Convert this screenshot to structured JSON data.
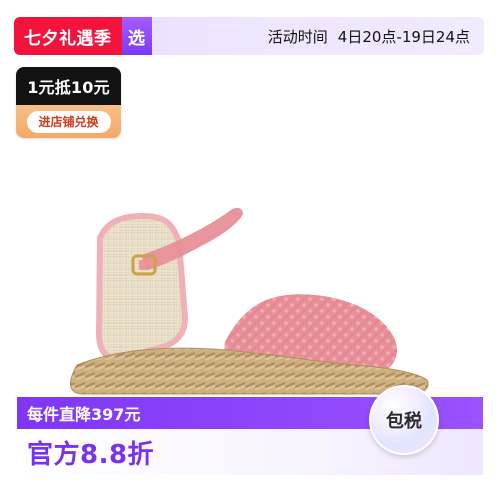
{
  "top_banner": {
    "festival_label": "七夕礼遇季",
    "select_label": "选",
    "activity_label": "活动时间",
    "activity_time": "4日20点-19日24点"
  },
  "coupon": {
    "title": "1元抵10元",
    "button_label": "进店铺兑换"
  },
  "product": {
    "icon": "pink-espadrille-wedge-sandal-image"
  },
  "bottom_band": {
    "discount_text": "每件直降397元",
    "official_price_text": "官方8.8折",
    "tax_badge_text": "包税"
  },
  "colors": {
    "festival_red": "#f2143d",
    "brand_purple": "#7f36f5",
    "coupon_black": "#121212",
    "coupon_orange": "#f4aa63",
    "shoe_pink": "#e88f98",
    "jute": "#cdb07f"
  }
}
